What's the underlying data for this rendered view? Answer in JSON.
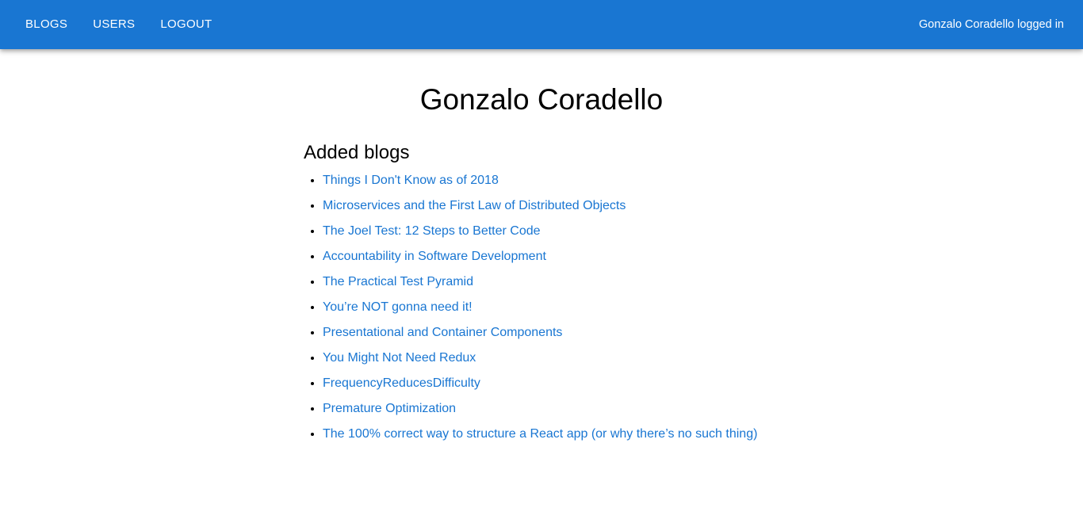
{
  "header": {
    "nav": [
      {
        "label": "BLOGS"
      },
      {
        "label": "USERS"
      },
      {
        "label": "LOGOUT"
      }
    ],
    "login_status": "Gonzalo Coradello logged in"
  },
  "main": {
    "user_name": "Gonzalo Coradello",
    "section_title": "Added blogs",
    "blogs": [
      {
        "title": "Things I Don't Know as of 2018"
      },
      {
        "title": "Microservices and the First Law of Distributed Objects"
      },
      {
        "title": "The Joel Test: 12 Steps to Better Code"
      },
      {
        "title": "Accountability in Software Development"
      },
      {
        "title": "The Practical Test Pyramid"
      },
      {
        "title": "You’re NOT gonna need it!"
      },
      {
        "title": "Presentational and Container Components"
      },
      {
        "title": "You Might Not Need Redux"
      },
      {
        "title": "FrequencyReducesDifficulty"
      },
      {
        "title": "Premature Optimization"
      },
      {
        "title": "The 100% correct way to structure a React app (or why there’s no such thing)"
      }
    ]
  },
  "colors": {
    "appbar": "#1976d2",
    "link": "#1976d2",
    "text": "#000000"
  }
}
